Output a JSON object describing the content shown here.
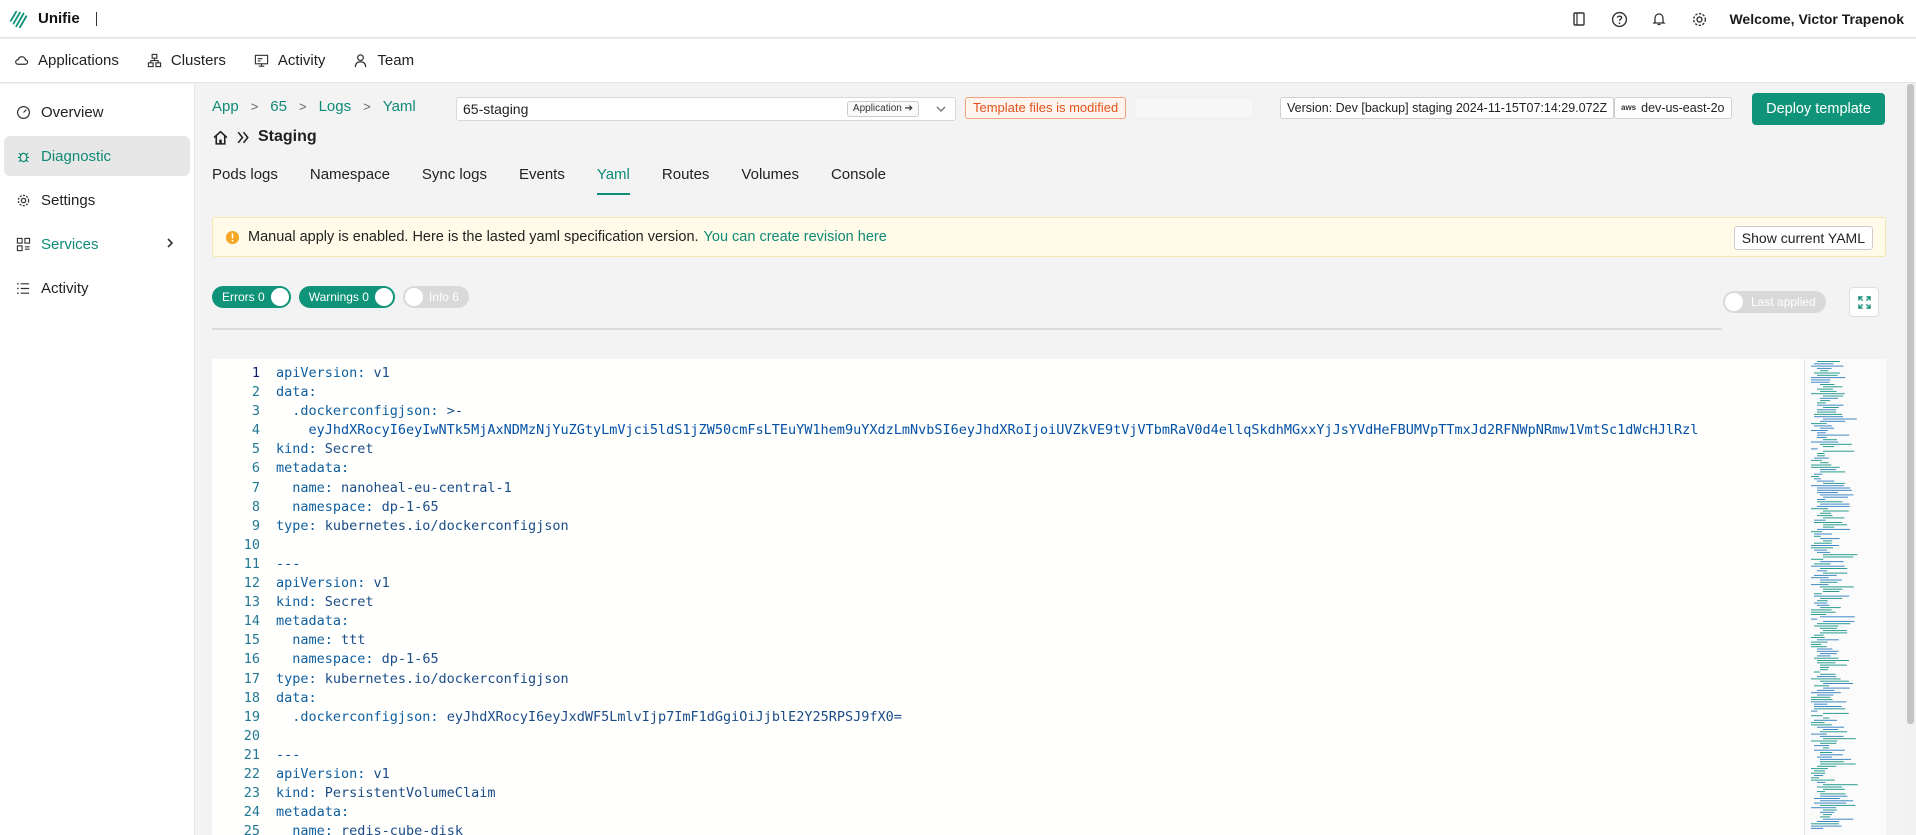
{
  "app": {
    "name": "Unifie"
  },
  "topbar": {
    "welcome": "Welcome, Victor Trapenok",
    "icons": [
      "book-icon",
      "help-icon",
      "bell-icon",
      "gear-icon"
    ]
  },
  "nav": {
    "items": [
      {
        "label": "Applications",
        "icon": "cloud-icon"
      },
      {
        "label": "Clusters",
        "icon": "cluster-icon"
      },
      {
        "label": "Activity",
        "icon": "monitor-icon"
      },
      {
        "label": "Team",
        "icon": "user-icon"
      }
    ]
  },
  "sidebar": {
    "items": [
      {
        "label": "Overview",
        "icon": "dashboard-icon"
      },
      {
        "label": "Diagnostic",
        "icon": "bug-icon"
      },
      {
        "label": "Settings",
        "icon": "settings-icon"
      },
      {
        "label": "Services",
        "icon": "services-icon"
      },
      {
        "label": "Activity",
        "icon": "list-icon"
      }
    ]
  },
  "breadcrumb": {
    "items": [
      "App",
      "65",
      "Logs",
      "Yaml"
    ]
  },
  "env_select": {
    "value": "65-staging",
    "badge": "Application ➔"
  },
  "status": {
    "template_modified": "Template files is modified",
    "version": "Version: Dev [backup] staging 2024-11-15T07:14:29.072Z",
    "region": "dev-us-east-2o",
    "aws": "aws"
  },
  "deploy_label": "Deploy template",
  "page_title": "Staging",
  "tabs": [
    "Pods logs",
    "Namespace",
    "Sync logs",
    "Events",
    "Yaml",
    "Routes",
    "Volumes",
    "Console"
  ],
  "banner": {
    "text": "Manual apply is enabled. Here is the lasted yaml specification version.",
    "link": "You can create revision here",
    "button": "Show current YAML"
  },
  "filters": {
    "errors": "Errors 0",
    "warnings": "Warnings 0",
    "info": "Info 6",
    "last_applied": "Last applied"
  },
  "colors": {
    "accent": "#0f9479",
    "warning": "#e0531c"
  },
  "editor": {
    "lines": [
      "apiVersion: v1",
      "data:",
      "  .dockerconfigjson: >-",
      "    eyJhdXRocyI6eyIwNTk5MjAxNDMzNjYuZGtyLmVjci5ldS1jZW50cmFsLTEuYW1hem9uYXdzLmNvbSI6eyJhdXRoIjoiUVZkVE9tVjVTbmRaV0d4ellqSkdhMGxxYjJsYVdHeFBUMVpTTmxJd2RFNWpNRmw1VmtSc1dWcHJlRzl",
      "kind: Secret",
      "metadata:",
      "  name: nanoheal-eu-central-1",
      "  namespace: dp-1-65",
      "type: kubernetes.io/dockerconfigjson",
      "",
      "---",
      "apiVersion: v1",
      "kind: Secret",
      "metadata:",
      "  name: ttt",
      "  namespace: dp-1-65",
      "type: kubernetes.io/dockerconfigjson",
      "data:",
      "  .dockerconfigjson: eyJhdXRocyI6eyJxdWF5LmlvIjp7ImF1dGgiOiJjblE2Y25RPSJ9fX0=",
      "",
      "---",
      "apiVersion: v1",
      "kind: PersistentVolumeClaim",
      "metadata:",
      "  name: redis-cube-disk"
    ]
  }
}
